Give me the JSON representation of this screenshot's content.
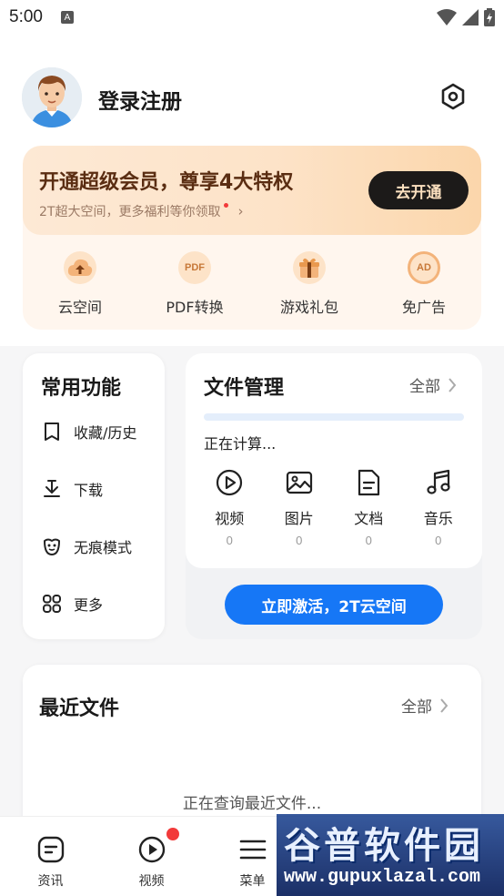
{
  "status_bar": {
    "time": "5:00",
    "notification_icon": "A"
  },
  "header": {
    "login_text": "登录注册"
  },
  "vip": {
    "title": "开通超级会员，尊享4大特权",
    "subtitle": "2T超大空间，更多福利等你领取",
    "button": "去开通",
    "features": [
      {
        "icon": "cloud-upload-icon",
        "label": "云空间"
      },
      {
        "icon": "pdf-icon",
        "icon_text": "PDF",
        "label": "PDF转换"
      },
      {
        "icon": "gift-icon",
        "label": "游戏礼包"
      },
      {
        "icon": "ad-free-icon",
        "icon_text": "AD",
        "label": "免广告"
      }
    ]
  },
  "common": {
    "title": "常用功能",
    "items": [
      {
        "icon": "bookmark-icon",
        "label": "收藏/历史"
      },
      {
        "icon": "download-icon",
        "label": "下载"
      },
      {
        "icon": "incognito-icon",
        "label": "无痕模式"
      },
      {
        "icon": "grid-icon",
        "label": "更多"
      }
    ]
  },
  "files": {
    "title": "文件管理",
    "all": "全部",
    "status": "正在计算...",
    "types": [
      {
        "icon": "video-icon",
        "label": "视频",
        "count": "0"
      },
      {
        "icon": "image-icon",
        "label": "图片",
        "count": "0"
      },
      {
        "icon": "document-icon",
        "label": "文档",
        "count": "0"
      },
      {
        "icon": "music-icon",
        "label": "音乐",
        "count": "0"
      }
    ],
    "activate": "立即激活，2T云空间"
  },
  "recent": {
    "title": "最近文件",
    "all": "全部",
    "status": "正在查询最近文件..."
  },
  "nav": [
    {
      "icon": "news-icon",
      "label": "资讯"
    },
    {
      "icon": "play-icon",
      "label": "视频",
      "badge": true
    },
    {
      "icon": "menu-icon",
      "label": "菜单"
    }
  ],
  "watermark": {
    "title": "谷普软件园",
    "url": "www.gupuxlazal.com"
  },
  "colors": {
    "accent_blue": "#1677f6",
    "vip_brown": "#5a2d12",
    "badge_red": "#f23a3a"
  }
}
